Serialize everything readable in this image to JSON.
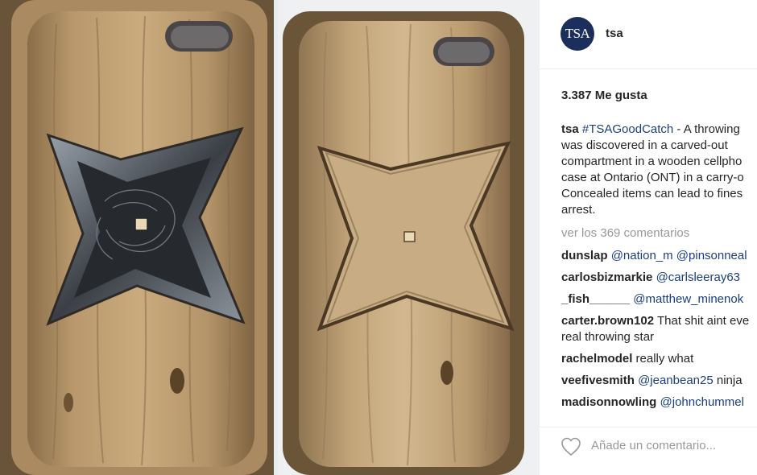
{
  "post": {
    "account_logo_text": "TSA",
    "username": "tsa",
    "likes": "3.387 Me gusta",
    "caption": {
      "user": "tsa",
      "hashtag": "#TSAGoodCatch",
      "line1_rest": " - A throwing",
      "line2": "was discovered in a carved-out",
      "line3": "compartment in a wooden cellpho",
      "line4": "case at Ontario (ONT) in a carry-o",
      "line5": "Concealed items can lead to fines",
      "line6": "arrest."
    },
    "view_comments": "ver los 369 comentarios",
    "comments": [
      {
        "user": "dunslap",
        "text": "@nation_m @pinsonneal",
        "is_mention": true
      },
      {
        "user": "carlosbizmarkie",
        "text": "@carlsleeray63",
        "is_mention": true
      },
      {
        "user": "_fish______",
        "text": "@matthew_minenok",
        "is_mention": true
      },
      {
        "user": "carter.brown102",
        "text": "That shit aint eve",
        "text_line2": "real throwing star",
        "is_mention": false
      },
      {
        "user": "rachelmodel",
        "text": "really what",
        "is_mention": false
      },
      {
        "user": "veefivesmith",
        "text": "@jeanbean25",
        "text_after": " ninja",
        "is_mention": true
      },
      {
        "user": "madisonnowling",
        "text": "@johnchummel",
        "is_mention": true
      }
    ],
    "add_comment_placeholder": "Añade un comentario...",
    "icons": {
      "like": "heart-icon"
    },
    "colors": {
      "mention": "#1b3f7c",
      "muted": "#999999",
      "logo_bg": "#1c2f5c"
    }
  }
}
